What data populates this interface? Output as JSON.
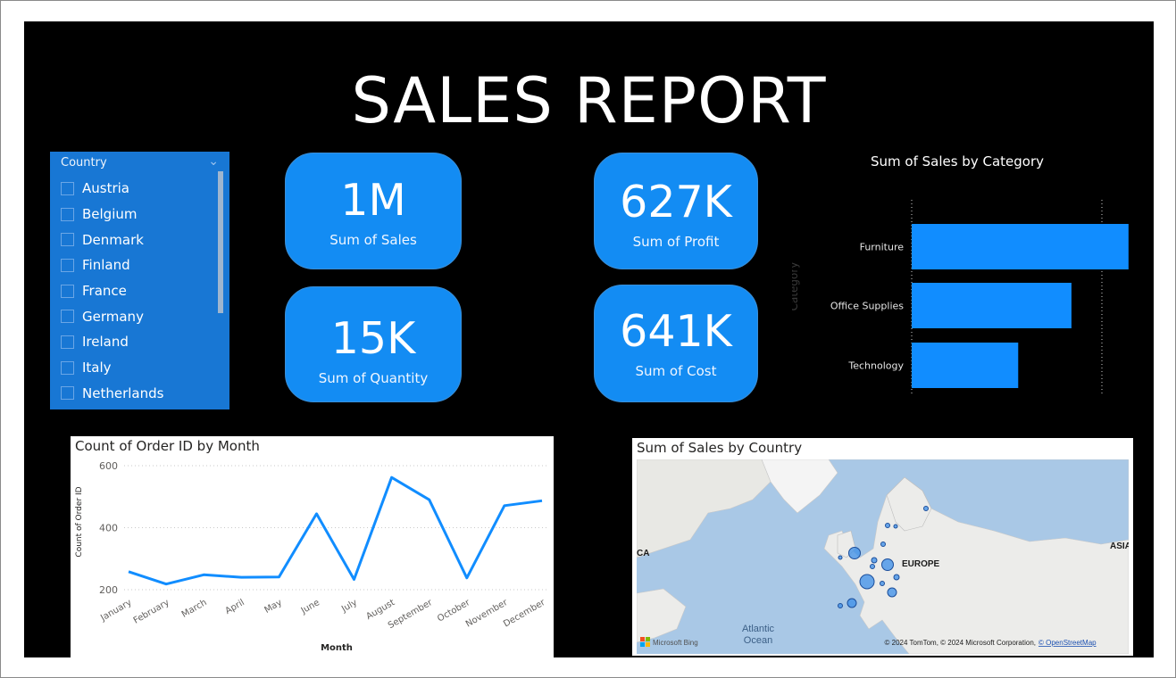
{
  "report": {
    "title": "SALES REPORT"
  },
  "slicer": {
    "header": "Country",
    "items": [
      "Austria",
      "Belgium",
      "Denmark",
      "Finland",
      "France",
      "Germany",
      "Ireland",
      "Italy",
      "Netherlands"
    ]
  },
  "kpis": {
    "sales": {
      "value": "1M",
      "label": "Sum of Sales"
    },
    "profit": {
      "value": "627K",
      "label": "Sum of Profit"
    },
    "quantity": {
      "value": "15K",
      "label": "Sum of Quantity"
    },
    "cost": {
      "value": "641K",
      "label": "Sum of Cost"
    }
  },
  "colors": {
    "accent": "#138cf3",
    "bar": "#118dff",
    "slicer_bg": "#1877d4",
    "background": "#000000"
  },
  "chart_data": [
    {
      "type": "bar",
      "orientation": "horizontal",
      "title": "Sum of Sales by Category",
      "ylabel": "Category",
      "xlabel": "",
      "categories": [
        "Furniture",
        "Office Supplies",
        "Technology"
      ],
      "values": [
        0.57,
        0.42,
        0.28
      ],
      "value_unit": "M",
      "xlim": [
        0,
        0.5
      ],
      "xticks": [
        "0.0M",
        "0.5M"
      ],
      "grid": true
    },
    {
      "type": "line",
      "title": "Count of Order ID by Month",
      "xlabel": "Month",
      "ylabel": "Count of Order ID",
      "categories": [
        "January",
        "February",
        "March",
        "April",
        "May",
        "June",
        "July",
        "August",
        "September",
        "October",
        "November",
        "December"
      ],
      "values": [
        258,
        218,
        248,
        240,
        241,
        445,
        233,
        562,
        490,
        238,
        471,
        487
      ],
      "yticks": [
        200,
        400,
        600
      ],
      "ylim": [
        200,
        600
      ],
      "grid": true
    }
  ],
  "map": {
    "title": "Sum of Sales by Country",
    "labels": {
      "ca": "CA",
      "europe": "EUROPE",
      "asia": "ASIA",
      "atlantic_1": "Atlantic",
      "atlantic_2": "Ocean"
    },
    "logo_text": "Microsoft Bing",
    "attribution": "© 2024 TomTom, © 2024 Microsoft Corporation,",
    "attribution_link": "© OpenStreetMap"
  }
}
